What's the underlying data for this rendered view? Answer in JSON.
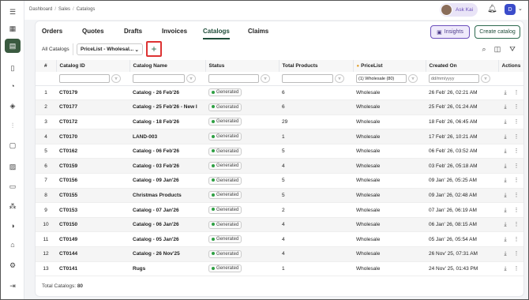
{
  "breadcrumb": [
    "Dashboard",
    "Sales",
    "Catalogs"
  ],
  "header": {
    "ask_label": "Ask Kai",
    "user_initial": "D"
  },
  "tabs": [
    "Orders",
    "Quotes",
    "Drafts",
    "Invoices",
    "Catalogs",
    "Claims"
  ],
  "active_tab": "Catalogs",
  "buttons": {
    "insights": "Insights",
    "create": "Create catalog"
  },
  "toolbar": {
    "all_catalogs": "All Catalogs",
    "pricelist_select": "PriceList - Wholesal..."
  },
  "columns": [
    "#",
    "Catalog ID",
    "Catalog Name",
    "Status",
    "Total Products",
    "PriceList",
    "Created On",
    "Actions"
  ],
  "filters": {
    "pricelist_value": "(1) Wholesale (80)",
    "date_placeholder": "dd/mm/yyyy"
  },
  "rows": [
    {
      "n": "1",
      "id": "CT0179",
      "name": "Catalog - 26 Feb'26",
      "status": "Generated",
      "products": "6",
      "pricelist": "Wholesale",
      "created": "26 Feb' 26, 02:21 AM"
    },
    {
      "n": "2",
      "id": "CT0177",
      "name": "Catalog - 25 Feb'26 - New I",
      "status": "Generated",
      "products": "6",
      "pricelist": "Wholesale",
      "created": "25 Feb' 26, 01:24 AM"
    },
    {
      "n": "3",
      "id": "CT0172",
      "name": "Catalog - 18 Feb'26",
      "status": "Generated",
      "products": "29",
      "pricelist": "Wholesale",
      "created": "18 Feb' 26, 06:45 AM"
    },
    {
      "n": "4",
      "id": "CT0170",
      "name": "LAND-003",
      "status": "Generated",
      "products": "1",
      "pricelist": "Wholesale",
      "created": "17 Feb' 26, 10:21 AM"
    },
    {
      "n": "5",
      "id": "CT0162",
      "name": "Catalog - 06 Feb'26",
      "status": "Generated",
      "products": "5",
      "pricelist": "Wholesale",
      "created": "06 Feb' 26, 03:52 AM"
    },
    {
      "n": "6",
      "id": "CT0159",
      "name": "Catalog - 03 Feb'26",
      "status": "Generated",
      "products": "4",
      "pricelist": "Wholesale",
      "created": "03 Feb' 26, 05:18 AM"
    },
    {
      "n": "7",
      "id": "CT0156",
      "name": "Catalog - 09 Jan'26",
      "status": "Generated",
      "products": "5",
      "pricelist": "Wholesale",
      "created": "09 Jan' 26, 05:25 AM"
    },
    {
      "n": "8",
      "id": "CT0155",
      "name": "Christmas Products",
      "status": "Generated",
      "products": "5",
      "pricelist": "Wholesale",
      "created": "09 Jan' 26, 02:48 AM"
    },
    {
      "n": "9",
      "id": "CT0153",
      "name": "Catalog - 07 Jan'26",
      "status": "Generated",
      "products": "2",
      "pricelist": "Wholesale",
      "created": "07 Jan' 26, 06:19 AM"
    },
    {
      "n": "10",
      "id": "CT0150",
      "name": "Catalog - 06 Jan'26",
      "status": "Generated",
      "products": "4",
      "pricelist": "Wholesale",
      "created": "06 Jan' 26, 08:15 AM"
    },
    {
      "n": "11",
      "id": "CT0149",
      "name": "Catalog - 05 Jan'26",
      "status": "Generated",
      "products": "4",
      "pricelist": "Wholesale",
      "created": "05 Jan' 26, 05:54 AM"
    },
    {
      "n": "12",
      "id": "CT0144",
      "name": "Catalog - 26 Nov'25",
      "status": "Generated",
      "products": "4",
      "pricelist": "Wholesale",
      "created": "26 Nov' 25, 07:31 AM"
    },
    {
      "n": "13",
      "id": "CT0141",
      "name": "Rugs",
      "status": "Generated",
      "products": "1",
      "pricelist": "Wholesale",
      "created": "24 Nov' 25, 01:43 PM"
    }
  ],
  "footer": {
    "label": "Total Catalogs:",
    "count": "80"
  },
  "colors": {
    "brand": "#3a5a40",
    "accent": "#6b4fbb",
    "highlight": "#dd3333"
  }
}
